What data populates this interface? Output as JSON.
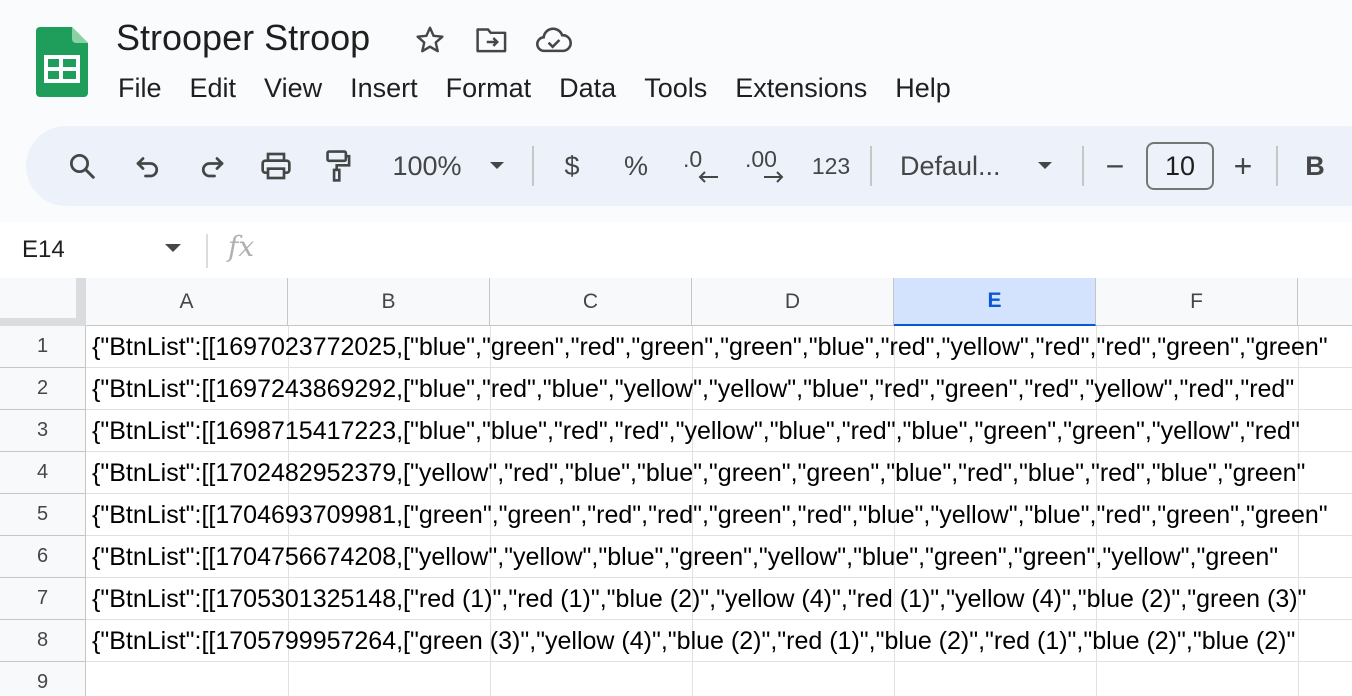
{
  "document": {
    "title": "Strooper Stroop"
  },
  "menu": [
    "File",
    "Edit",
    "View",
    "Insert",
    "Format",
    "Data",
    "Tools",
    "Extensions",
    "Help"
  ],
  "toolbar": {
    "zoom": "100%",
    "currency": "$",
    "percent": "%",
    "decrease_decimal": ".0",
    "increase_decimal": ".00",
    "number_format": "123",
    "font": "Defaul...",
    "font_size_minus": "−",
    "font_size": "10",
    "font_size_plus": "+",
    "bold": "B"
  },
  "formula_bar": {
    "cell_ref": "E14",
    "fx": "fx"
  },
  "columns": [
    "A",
    "B",
    "C",
    "D",
    "E",
    "F"
  ],
  "active_column": "E",
  "rows": [
    {
      "num": "1",
      "text": "{\"BtnList\":[[1697023772025,[\"blue\",\"green\",\"red\",\"green\",\"green\",\"blue\",\"red\",\"yellow\",\"red\",\"red\",\"green\",\"green\""
    },
    {
      "num": "2",
      "text": "{\"BtnList\":[[1697243869292,[\"blue\",\"red\",\"blue\",\"yellow\",\"yellow\",\"blue\",\"red\",\"green\",\"red\",\"yellow\",\"red\",\"red\""
    },
    {
      "num": "3",
      "text": "{\"BtnList\":[[1698715417223,[\"blue\",\"blue\",\"red\",\"red\",\"yellow\",\"blue\",\"red\",\"blue\",\"green\",\"green\",\"yellow\",\"red\""
    },
    {
      "num": "4",
      "text": "{\"BtnList\":[[1702482952379,[\"yellow\",\"red\",\"blue\",\"blue\",\"green\",\"green\",\"blue\",\"red\",\"blue\",\"red\",\"blue\",\"green\""
    },
    {
      "num": "5",
      "text": "{\"BtnList\":[[1704693709981,[\"green\",\"green\",\"red\",\"red\",\"green\",\"red\",\"blue\",\"yellow\",\"blue\",\"red\",\"green\",\"green\""
    },
    {
      "num": "6",
      "text": "{\"BtnList\":[[1704756674208,[\"yellow\",\"yellow\",\"blue\",\"green\",\"yellow\",\"blue\",\"green\",\"green\",\"yellow\",\"green\""
    },
    {
      "num": "7",
      "text": "{\"BtnList\":[[1705301325148,[\"red (1)\",\"red (1)\",\"blue (2)\",\"yellow (4)\",\"red (1)\",\"yellow (4)\",\"blue (2)\",\"green (3)\""
    },
    {
      "num": "8",
      "text": "{\"BtnList\":[[1705799957264,[\"green (3)\",\"yellow (4)\",\"blue (2)\",\"red (1)\",\"blue (2)\",\"red (1)\",\"blue (2)\",\"blue (2)\""
    },
    {
      "num": "9",
      "text": ""
    }
  ],
  "colors": {
    "logo_green": "#0f9d58",
    "toolbar_bg": "#edf2fa",
    "active_header_bg": "#d3e3fd",
    "active_header_text": "#0b57d0"
  },
  "icons": [
    "sheets-logo",
    "star-icon",
    "move-folder-icon",
    "cloud-status-icon",
    "search-icon",
    "undo-icon",
    "redo-icon",
    "print-icon",
    "paint-format-icon",
    "chevron-down-icon"
  ]
}
